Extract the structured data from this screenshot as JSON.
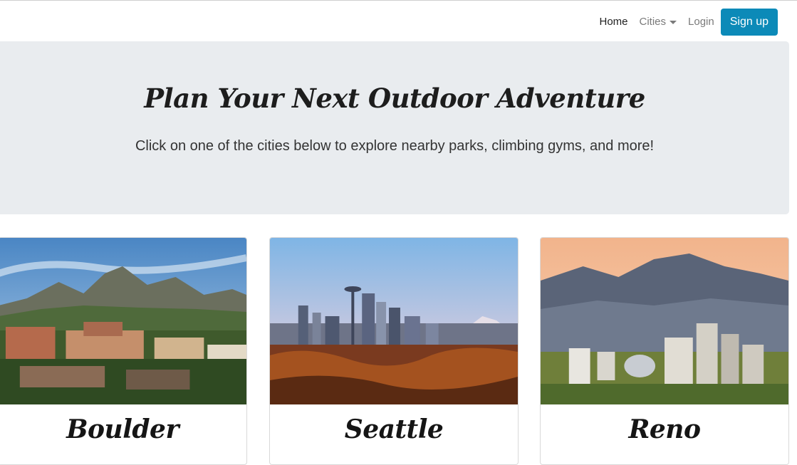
{
  "nav": {
    "home": "Home",
    "cities": "Cities",
    "login": "Login",
    "signup": "Sign up"
  },
  "hero": {
    "title": "Plan Your Next Outdoor Adventure",
    "subtitle": "Click on one of the cities below to explore nearby parks, climbing gyms, and more!"
  },
  "cards": [
    {
      "name": "Boulder"
    },
    {
      "name": "Seattle"
    },
    {
      "name": "Reno"
    }
  ],
  "colors": {
    "accent": "#0c8ab8",
    "jumbotron_bg": "#e9ecef"
  }
}
